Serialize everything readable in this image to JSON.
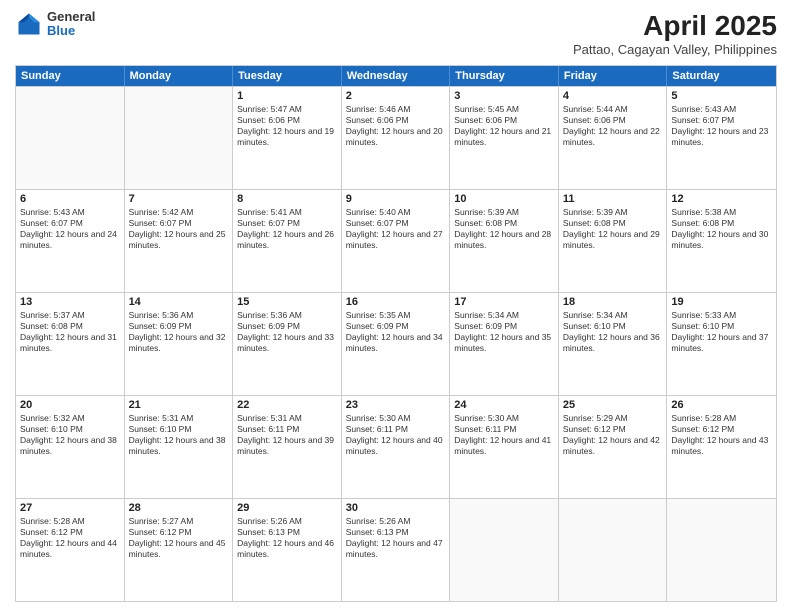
{
  "header": {
    "logo": {
      "general": "General",
      "blue": "Blue"
    },
    "title": "April 2025",
    "location": "Pattao, Cagayan Valley, Philippines"
  },
  "calendar": {
    "days_of_week": [
      "Sunday",
      "Monday",
      "Tuesday",
      "Wednesday",
      "Thursday",
      "Friday",
      "Saturday"
    ],
    "rows": [
      [
        {
          "day": "",
          "sunrise": "",
          "sunset": "",
          "daylight": ""
        },
        {
          "day": "",
          "sunrise": "",
          "sunset": "",
          "daylight": ""
        },
        {
          "day": "1",
          "sunrise": "Sunrise: 5:47 AM",
          "sunset": "Sunset: 6:06 PM",
          "daylight": "Daylight: 12 hours and 19 minutes."
        },
        {
          "day": "2",
          "sunrise": "Sunrise: 5:46 AM",
          "sunset": "Sunset: 6:06 PM",
          "daylight": "Daylight: 12 hours and 20 minutes."
        },
        {
          "day": "3",
          "sunrise": "Sunrise: 5:45 AM",
          "sunset": "Sunset: 6:06 PM",
          "daylight": "Daylight: 12 hours and 21 minutes."
        },
        {
          "day": "4",
          "sunrise": "Sunrise: 5:44 AM",
          "sunset": "Sunset: 6:06 PM",
          "daylight": "Daylight: 12 hours and 22 minutes."
        },
        {
          "day": "5",
          "sunrise": "Sunrise: 5:43 AM",
          "sunset": "Sunset: 6:07 PM",
          "daylight": "Daylight: 12 hours and 23 minutes."
        }
      ],
      [
        {
          "day": "6",
          "sunrise": "Sunrise: 5:43 AM",
          "sunset": "Sunset: 6:07 PM",
          "daylight": "Daylight: 12 hours and 24 minutes."
        },
        {
          "day": "7",
          "sunrise": "Sunrise: 5:42 AM",
          "sunset": "Sunset: 6:07 PM",
          "daylight": "Daylight: 12 hours and 25 minutes."
        },
        {
          "day": "8",
          "sunrise": "Sunrise: 5:41 AM",
          "sunset": "Sunset: 6:07 PM",
          "daylight": "Daylight: 12 hours and 26 minutes."
        },
        {
          "day": "9",
          "sunrise": "Sunrise: 5:40 AM",
          "sunset": "Sunset: 6:07 PM",
          "daylight": "Daylight: 12 hours and 27 minutes."
        },
        {
          "day": "10",
          "sunrise": "Sunrise: 5:39 AM",
          "sunset": "Sunset: 6:08 PM",
          "daylight": "Daylight: 12 hours and 28 minutes."
        },
        {
          "day": "11",
          "sunrise": "Sunrise: 5:39 AM",
          "sunset": "Sunset: 6:08 PM",
          "daylight": "Daylight: 12 hours and 29 minutes."
        },
        {
          "day": "12",
          "sunrise": "Sunrise: 5:38 AM",
          "sunset": "Sunset: 6:08 PM",
          "daylight": "Daylight: 12 hours and 30 minutes."
        }
      ],
      [
        {
          "day": "13",
          "sunrise": "Sunrise: 5:37 AM",
          "sunset": "Sunset: 6:08 PM",
          "daylight": "Daylight: 12 hours and 31 minutes."
        },
        {
          "day": "14",
          "sunrise": "Sunrise: 5:36 AM",
          "sunset": "Sunset: 6:09 PM",
          "daylight": "Daylight: 12 hours and 32 minutes."
        },
        {
          "day": "15",
          "sunrise": "Sunrise: 5:36 AM",
          "sunset": "Sunset: 6:09 PM",
          "daylight": "Daylight: 12 hours and 33 minutes."
        },
        {
          "day": "16",
          "sunrise": "Sunrise: 5:35 AM",
          "sunset": "Sunset: 6:09 PM",
          "daylight": "Daylight: 12 hours and 34 minutes."
        },
        {
          "day": "17",
          "sunrise": "Sunrise: 5:34 AM",
          "sunset": "Sunset: 6:09 PM",
          "daylight": "Daylight: 12 hours and 35 minutes."
        },
        {
          "day": "18",
          "sunrise": "Sunrise: 5:34 AM",
          "sunset": "Sunset: 6:10 PM",
          "daylight": "Daylight: 12 hours and 36 minutes."
        },
        {
          "day": "19",
          "sunrise": "Sunrise: 5:33 AM",
          "sunset": "Sunset: 6:10 PM",
          "daylight": "Daylight: 12 hours and 37 minutes."
        }
      ],
      [
        {
          "day": "20",
          "sunrise": "Sunrise: 5:32 AM",
          "sunset": "Sunset: 6:10 PM",
          "daylight": "Daylight: 12 hours and 38 minutes."
        },
        {
          "day": "21",
          "sunrise": "Sunrise: 5:31 AM",
          "sunset": "Sunset: 6:10 PM",
          "daylight": "Daylight: 12 hours and 38 minutes."
        },
        {
          "day": "22",
          "sunrise": "Sunrise: 5:31 AM",
          "sunset": "Sunset: 6:11 PM",
          "daylight": "Daylight: 12 hours and 39 minutes."
        },
        {
          "day": "23",
          "sunrise": "Sunrise: 5:30 AM",
          "sunset": "Sunset: 6:11 PM",
          "daylight": "Daylight: 12 hours and 40 minutes."
        },
        {
          "day": "24",
          "sunrise": "Sunrise: 5:30 AM",
          "sunset": "Sunset: 6:11 PM",
          "daylight": "Daylight: 12 hours and 41 minutes."
        },
        {
          "day": "25",
          "sunrise": "Sunrise: 5:29 AM",
          "sunset": "Sunset: 6:12 PM",
          "daylight": "Daylight: 12 hours and 42 minutes."
        },
        {
          "day": "26",
          "sunrise": "Sunrise: 5:28 AM",
          "sunset": "Sunset: 6:12 PM",
          "daylight": "Daylight: 12 hours and 43 minutes."
        }
      ],
      [
        {
          "day": "27",
          "sunrise": "Sunrise: 5:28 AM",
          "sunset": "Sunset: 6:12 PM",
          "daylight": "Daylight: 12 hours and 44 minutes."
        },
        {
          "day": "28",
          "sunrise": "Sunrise: 5:27 AM",
          "sunset": "Sunset: 6:12 PM",
          "daylight": "Daylight: 12 hours and 45 minutes."
        },
        {
          "day": "29",
          "sunrise": "Sunrise: 5:26 AM",
          "sunset": "Sunset: 6:13 PM",
          "daylight": "Daylight: 12 hours and 46 minutes."
        },
        {
          "day": "30",
          "sunrise": "Sunrise: 5:26 AM",
          "sunset": "Sunset: 6:13 PM",
          "daylight": "Daylight: 12 hours and 47 minutes."
        },
        {
          "day": "",
          "sunrise": "",
          "sunset": "",
          "daylight": ""
        },
        {
          "day": "",
          "sunrise": "",
          "sunset": "",
          "daylight": ""
        },
        {
          "day": "",
          "sunrise": "",
          "sunset": "",
          "daylight": ""
        }
      ]
    ]
  }
}
